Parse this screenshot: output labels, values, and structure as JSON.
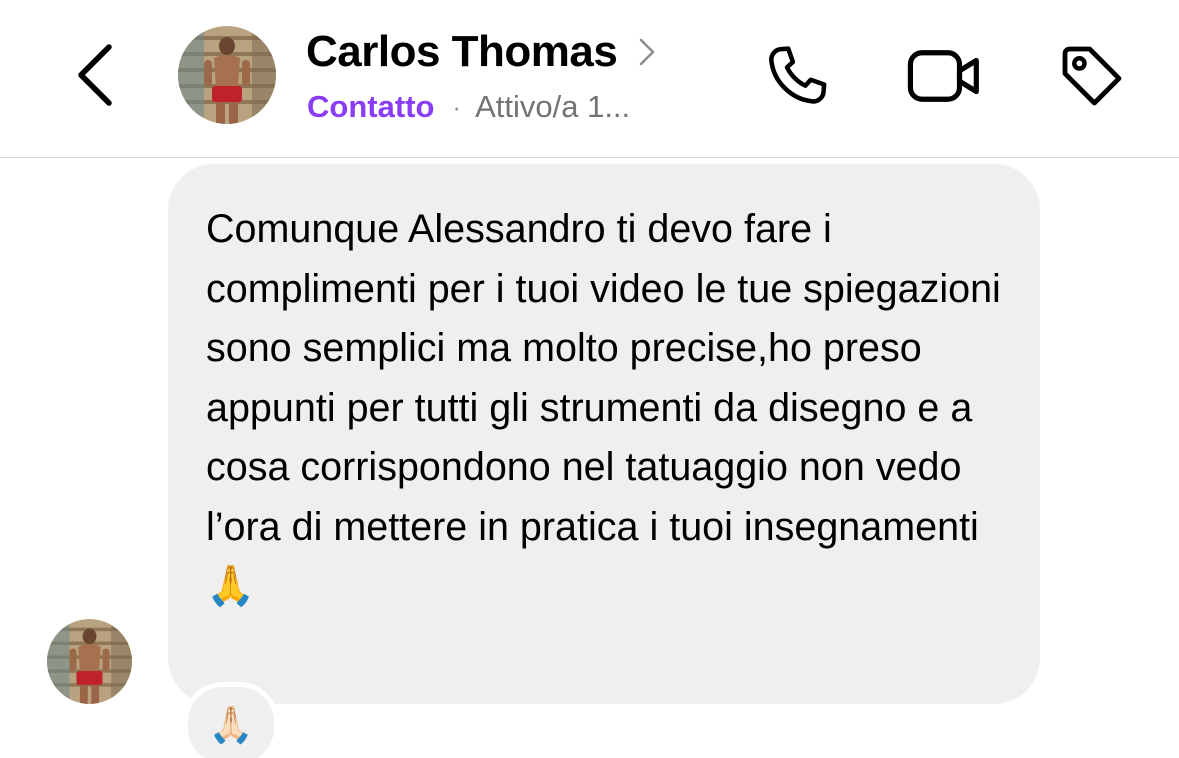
{
  "header": {
    "contact_name": "Carlos Thomas",
    "contact_tag": "Contatto",
    "separator": "·",
    "active_status": "Attivo/a 1..."
  },
  "icons": {
    "back": "chevron-left-icon",
    "name_chevron": "chevron-right-icon",
    "phone": "phone-icon",
    "video": "video-camera-icon",
    "tag": "tag-icon"
  },
  "message": {
    "text": "Comunque Alessandro ti devo fare i complimenti per i tuoi video le tue spiegazioni sono semplici ma molto precise,ho preso appunti per tutti gli strumenti da disegno e a cosa corrispondono nel tatuaggio non vedo l’ora di mettere in pratica i tuoi insegnamenti 🙏",
    "reaction": "🙏🏻"
  },
  "colors": {
    "accent_purple": "#8b3df5",
    "bubble_bg": "#efefef",
    "status_gray": "#737373"
  }
}
